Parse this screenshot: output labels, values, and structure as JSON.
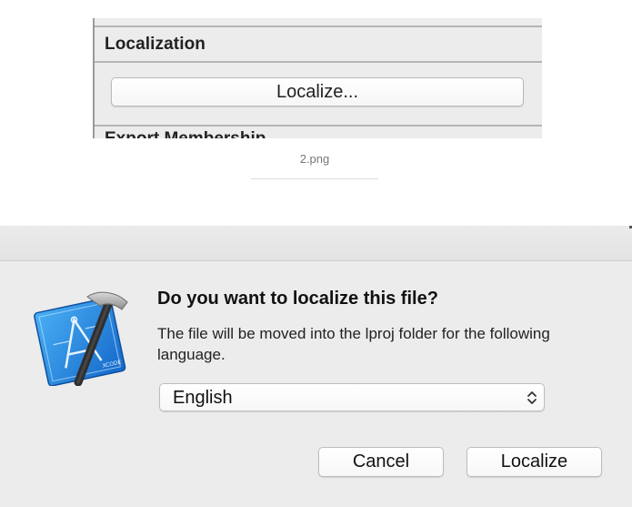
{
  "inspector": {
    "section_title": "Localization",
    "localize_button_label": "Localize...",
    "next_section_partial": "Export Membership"
  },
  "caption": {
    "filename": "2.png"
  },
  "dialog": {
    "title": "Do you want to localize this file?",
    "message": "The file will be moved into the lproj folder for the following language.",
    "language_select": {
      "selected": "English"
    },
    "buttons": {
      "cancel": "Cancel",
      "localize": "Localize"
    },
    "app_icon": "xcode-icon",
    "app_icon_label": "XCODE"
  },
  "colors": {
    "panel_bg": "#ececec",
    "icon_blue": "#1d7fd8",
    "hammer_handle": "#333333"
  }
}
